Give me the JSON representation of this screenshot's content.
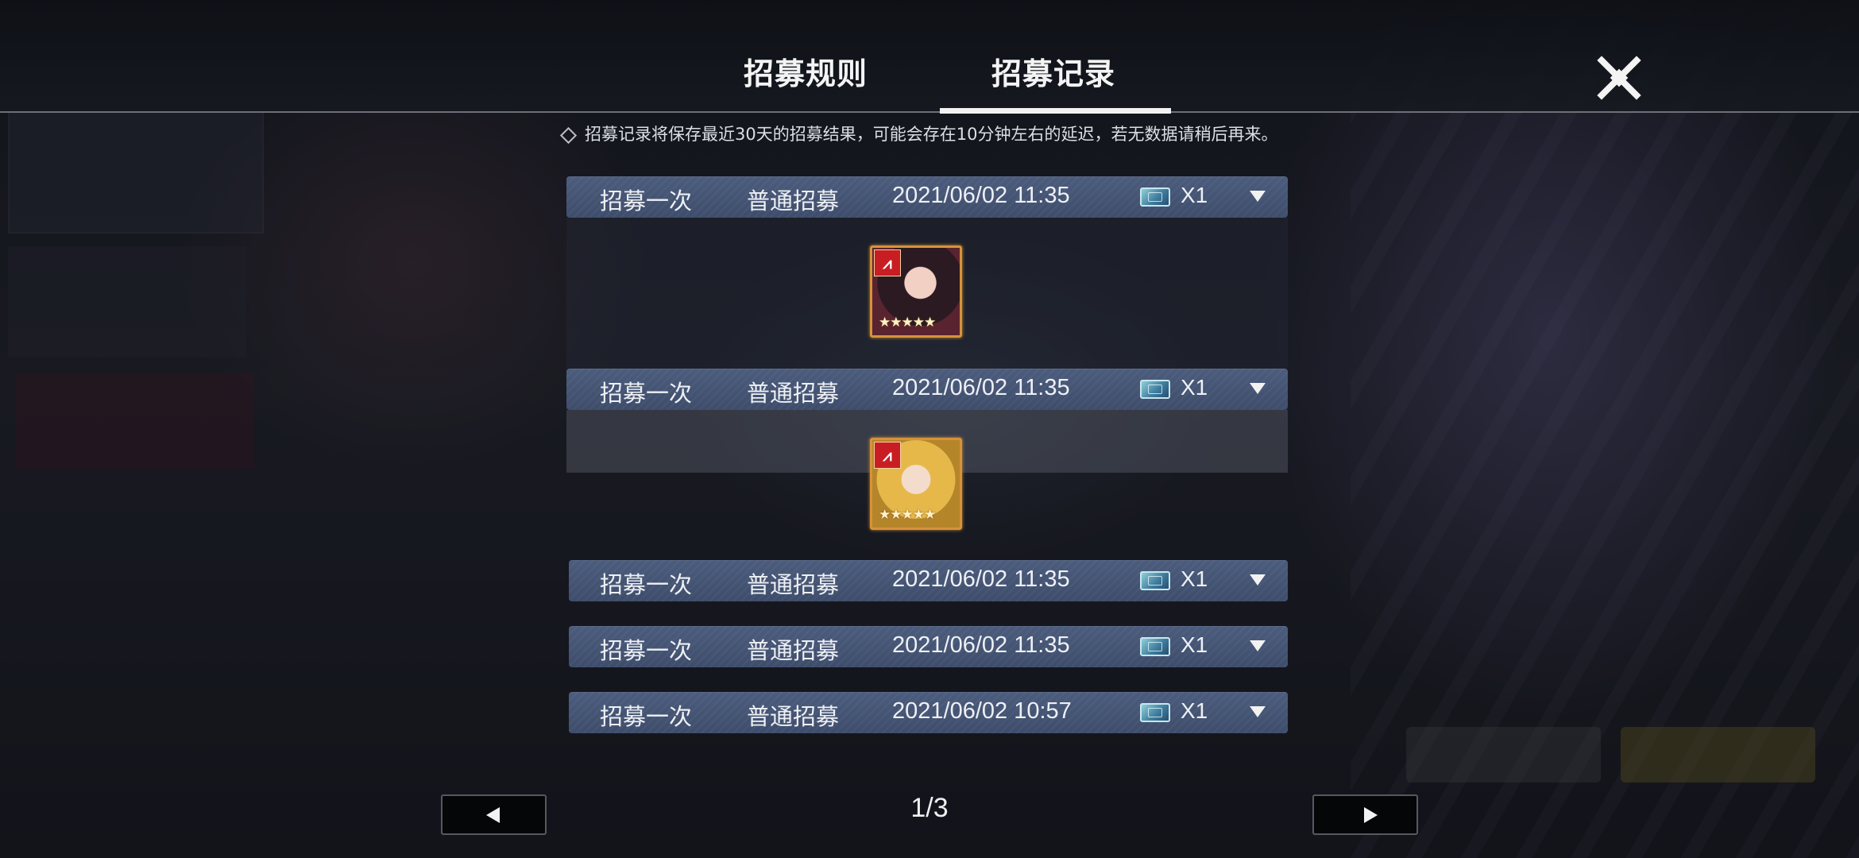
{
  "header": {
    "tabs": [
      {
        "label": "招募规则",
        "active": false
      },
      {
        "label": "招募记录",
        "active": true
      }
    ],
    "close_icon": "close-icon"
  },
  "notice": {
    "text": "招募记录将保存最近30天的招募结果，可能会存在10分钟左右的延迟，若无数据请稍后再来。"
  },
  "records": [
    {
      "type": "招募一次",
      "pool": "普通招募",
      "time": "2021/06/02 11:35",
      "count": "X1",
      "expanded": true,
      "result_icon": "character-portrait-dark-hair"
    },
    {
      "type": "招募一次",
      "pool": "普通招募",
      "time": "2021/06/02 11:35",
      "count": "X1",
      "expanded": true,
      "result_icon": "character-portrait-blonde"
    },
    {
      "type": "招募一次",
      "pool": "普通招募",
      "time": "2021/06/02 11:35",
      "count": "X1",
      "expanded": false
    },
    {
      "type": "招募一次",
      "pool": "普通招募",
      "time": "2021/06/02 11:35",
      "count": "X1",
      "expanded": false
    },
    {
      "type": "招募一次",
      "pool": "普通招募",
      "time": "2021/06/02 10:57",
      "count": "X1",
      "expanded": false
    }
  ],
  "result_card": {
    "badge_icon": "faction-badge-icon",
    "stars": "★★★★★",
    "border_color": "#d7923a"
  },
  "pagination": {
    "indicator": "1/3",
    "prev_icon": "prev-arrow-icon",
    "next_icon": "next-arrow-icon"
  },
  "colors": {
    "row_bg": "#44546f",
    "accent_underline": "#f2f2f2",
    "badge_red": "#c91d24"
  }
}
